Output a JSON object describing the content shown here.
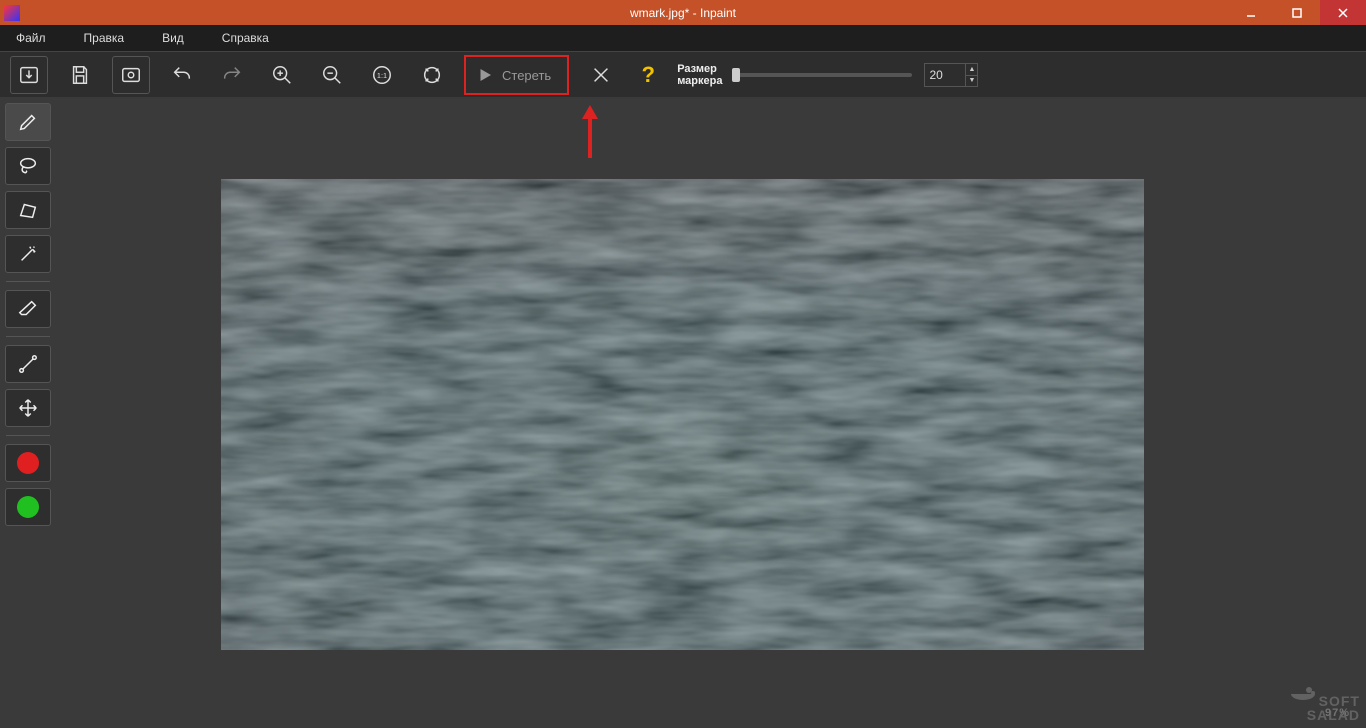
{
  "titlebar": {
    "title": "wmark.jpg* - Inpaint"
  },
  "menubar": {
    "items": [
      "Файл",
      "Правка",
      "Вид",
      "Справка"
    ]
  },
  "toolbar": {
    "erase_label": "Стереть",
    "marker_label_line1": "Размер",
    "marker_label_line2": "маркера",
    "marker_value": "20"
  },
  "colors": {
    "highlight": "#d22222",
    "help_icon": "#f2c200",
    "dot_red": "#e02020",
    "dot_green": "#20c020"
  },
  "watermark": {
    "line1": "SOFT",
    "line2": "SALAD",
    "percent": "97%"
  }
}
